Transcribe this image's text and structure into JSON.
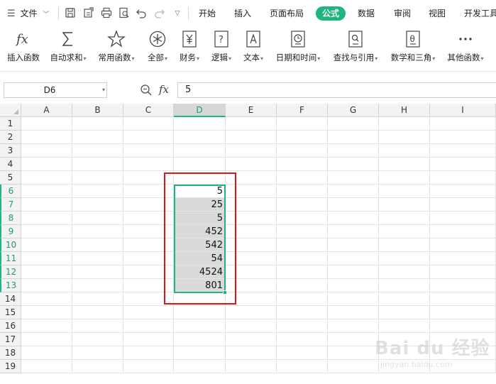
{
  "menubar": {
    "file_menu": "文件",
    "tabs": [
      {
        "label": "开始"
      },
      {
        "label": "插入"
      },
      {
        "label": "页面布局"
      },
      {
        "label": "公式"
      },
      {
        "label": "数据"
      },
      {
        "label": "审阅"
      },
      {
        "label": "视图"
      },
      {
        "label": "开发工具"
      }
    ],
    "active_tab": "公式",
    "accent_color": "#1fb57d"
  },
  "ribbon": {
    "buttons": [
      {
        "label": "插入函数",
        "icon": "fx-icon"
      },
      {
        "label": "自动求和",
        "icon": "sigma-icon"
      },
      {
        "label": "常用函数",
        "icon": "star-icon"
      },
      {
        "label": "全部",
        "icon": "asterisk-circle-icon"
      },
      {
        "label": "财务",
        "icon": "yen-icon"
      },
      {
        "label": "逻辑",
        "icon": "question-icon"
      },
      {
        "label": "文本",
        "icon": "text-a-icon"
      },
      {
        "label": "日期和时间",
        "icon": "clock-icon"
      },
      {
        "label": "查找与引用",
        "icon": "search-doc-icon"
      },
      {
        "label": "数学和三角",
        "icon": "theta-icon"
      },
      {
        "label": "其他函数",
        "icon": "more-dots-icon"
      }
    ]
  },
  "formula_bar": {
    "name_box": "D6",
    "fx": "fx",
    "value": "5"
  },
  "sheet": {
    "columns": [
      "A",
      "B",
      "C",
      "D",
      "E",
      "F",
      "G",
      "H",
      "I"
    ],
    "rows": [
      "1",
      "2",
      "3",
      "4",
      "5",
      "6",
      "7",
      "8",
      "9",
      "10",
      "11",
      "12",
      "13",
      "14",
      "15",
      "16",
      "17",
      "18",
      "19"
    ],
    "selected_column": "D",
    "selected_rows": [
      "6",
      "7",
      "8",
      "9",
      "10",
      "11",
      "12",
      "13"
    ],
    "column_d_values": [
      "5",
      "25",
      "5",
      "452",
      "542",
      "54",
      "4524",
      "801"
    ]
  },
  "watermark": {
    "brand": "Bai du 经验",
    "url": "jingyan.baidu.com"
  }
}
